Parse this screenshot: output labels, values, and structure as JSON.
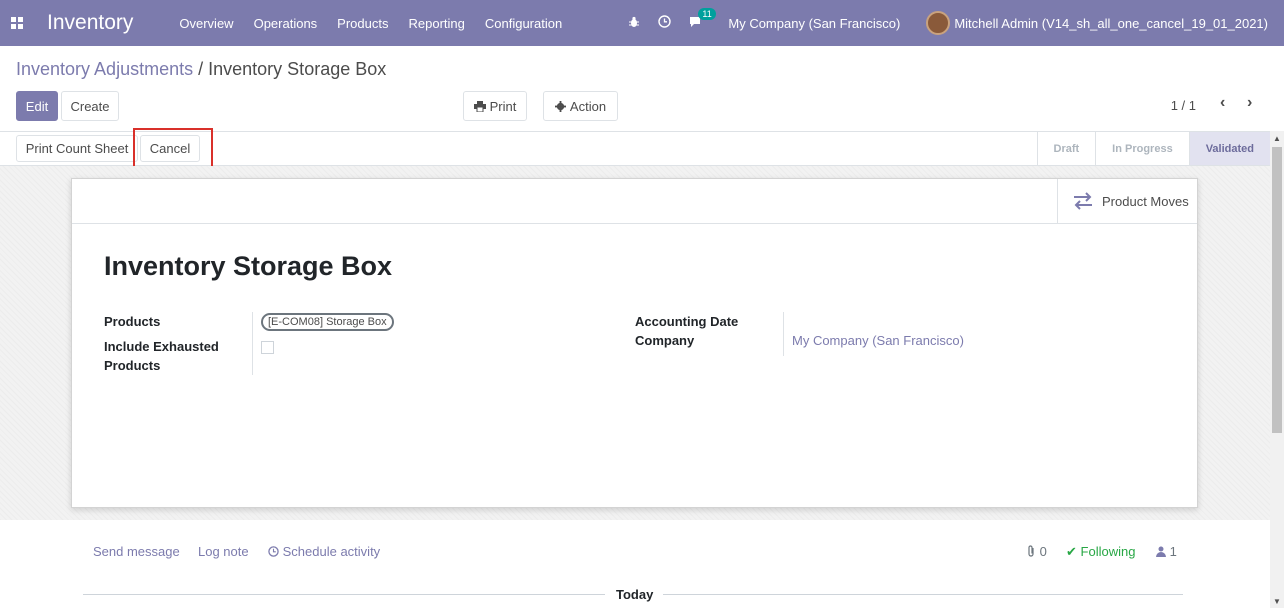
{
  "navbar": {
    "app_name": "Inventory",
    "menu": [
      "Overview",
      "Operations",
      "Products",
      "Reporting",
      "Configuration"
    ],
    "message_count": "11",
    "company": "My Company (San Francisco)",
    "user": "Mitchell Admin (V14_sh_all_one_cancel_19_01_2021)",
    "bar_color": "#7c7bad"
  },
  "breadcrumb": {
    "parent": "Inventory Adjustments",
    "separator": "/",
    "current": "Inventory Storage Box"
  },
  "toolbar": {
    "edit": "Edit",
    "create": "Create",
    "print": "Print",
    "action": "Action",
    "pager": "1 / 1"
  },
  "statusbar": {
    "print_count_sheet": "Print Count Sheet",
    "cancel": "Cancel",
    "steps": [
      "Draft",
      "In Progress",
      "Validated"
    ],
    "active_step": "Validated"
  },
  "sheet": {
    "smart_button": "Product Moves",
    "title": "Inventory Storage Box",
    "products_label": "Products",
    "products_tag": "[E-COM08] Storage Box",
    "include_exhausted_label_1": "Include Exhausted",
    "include_exhausted_label_2": "Products",
    "accounting_date_label": "Accounting Date",
    "company_label": "Company",
    "company_value": "My Company (San Francisco)"
  },
  "chatter": {
    "send_message": "Send message",
    "log_note": "Log note",
    "schedule_activity": "Schedule activity",
    "attachments": "0",
    "following": "Following",
    "followers": "1",
    "today": "Today"
  },
  "colors": {
    "accent": "#7c7bad",
    "highlight": "#d9302a",
    "following": "#28a745"
  }
}
